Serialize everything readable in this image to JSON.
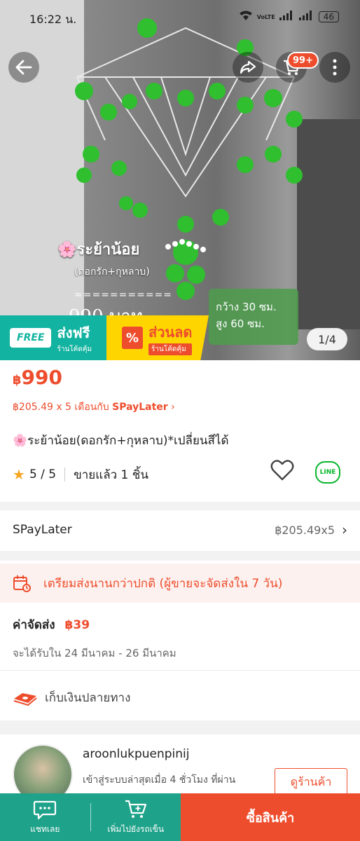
{
  "status_bar": {
    "time": "16:22 น.",
    "battery": "46",
    "network": "VoLTE"
  },
  "hero": {
    "title_line1": "🌸ระย้าน้อย",
    "title_line2": "(ดอกรัก+กุหลาบ)",
    "dashes": "===========",
    "price_art": "990 บาท",
    "size_width": "กว้าง 30 ซม.",
    "size_height": "สูง 60 ซม.",
    "page_indicator": "1/4"
  },
  "header": {
    "cart_badge": "99+"
  },
  "promo": {
    "free_tag": "FREE",
    "free_title": "ส่งฟรี",
    "free_sub": "ร้านโค้ดคุ้ม",
    "disc_title": "ส่วนลด",
    "disc_sub": "ร้านโค้ดคุ้ม"
  },
  "product": {
    "currency": "฿",
    "price": "990",
    "installment_text": "฿205.49 x 5 เดือนกับ",
    "installment_brand": "SPayLater",
    "name": "🌸ระย้าน้อย(ดอกรัก+กุหลาบ)*เปลี่ยนสีได้",
    "rating": "5 / 5",
    "sold": "ขายแล้ว 1 ชิ้น"
  },
  "spaylater": {
    "label": "SPayLater",
    "value": "฿205.49x5"
  },
  "shipping": {
    "prep_notice": "เตรียมส่งนานกว่าปกติ (ผู้ขายจะจัดส่งใน 7 วัน)",
    "fee_label": "ค่าจัดส่ง",
    "fee": "฿39",
    "receive": "จะได้รับใน 24 มีนาคม - 26 มีนาคม",
    "cod": "เก็บเงินปลายทาง"
  },
  "shop": {
    "name": "aroonlukpuenpinij",
    "last_seen": "เข้าสู่ระบบล่าสุดเมื่อ 4 ชั่วโมง ที่ผ่าน",
    "view_button": "ดูร้านค้า"
  },
  "bottom_bar": {
    "chat": "แชทเลย",
    "add_cart": "เพิ่มไปยังรถเข็น",
    "buy": "ซื้อสินค้า"
  },
  "colors": {
    "accent": "#ee4d2d",
    "teal": "#1ea289",
    "free_teal": "#12b3a0",
    "yellow": "#ffd500"
  }
}
